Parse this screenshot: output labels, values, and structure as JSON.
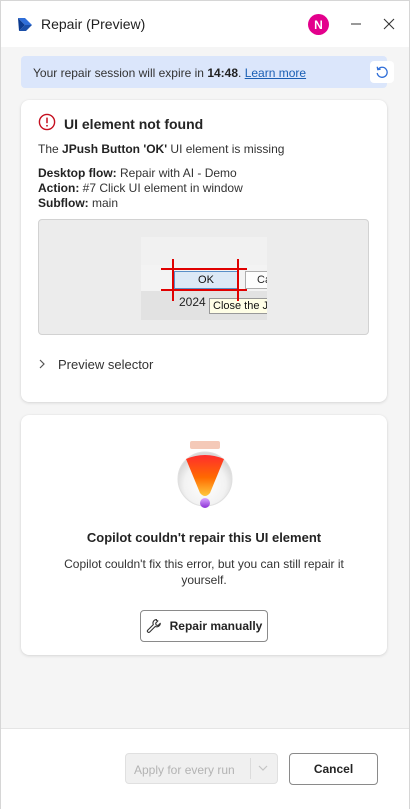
{
  "window": {
    "title": "Repair (Preview)",
    "avatar_initial": "N",
    "avatar_color": "#e3008c"
  },
  "banner": {
    "text_prefix": "Your repair session will expire in ",
    "time": "14:48",
    "text_suffix": ". ",
    "link_label": "Learn more",
    "refresh_icon": "refresh-icon"
  },
  "error": {
    "title": "UI element not found",
    "desc_prefix": "The ",
    "desc_bold": "JPush Button 'OK'",
    "desc_suffix": " UI element is missing",
    "desktop_flow_label": "Desktop flow:",
    "desktop_flow_value": " Repair with AI - Demo",
    "action_label": "Action:",
    "action_value": " #7 Click UI element in window",
    "subflow_label": "Subflow:",
    "subflow_value": " main",
    "preview_selector_label": "Preview selector"
  },
  "screenshot": {
    "ok_label": "OK",
    "cancel_label": "Ca",
    "year_label": "2024",
    "tooltip_label": "Close the J"
  },
  "copilot": {
    "title": "Copilot couldn't repair this UI element",
    "description": "Copilot couldn't fix this error, but you can still repair it yourself.",
    "repair_label": "Repair manually",
    "repair_icon": "wrench-icon"
  },
  "footer": {
    "apply_label": "Apply for every run",
    "cancel_label": "Cancel"
  },
  "colors": {
    "accent_link": "#1a5fb4",
    "banner_bg": "#dbe6fb",
    "error_red": "#c50f1f"
  }
}
